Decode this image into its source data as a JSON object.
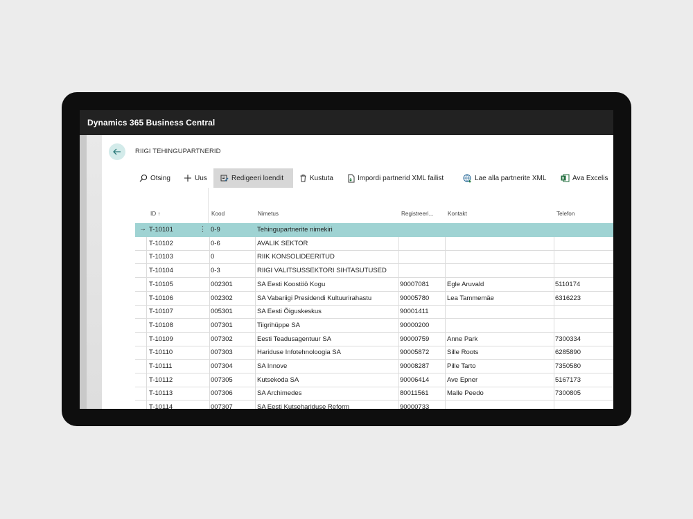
{
  "app": {
    "title": "Dynamics 365 Business Central"
  },
  "page": {
    "title": "RIIGI TEHINGUPARTNERID"
  },
  "toolbar": {
    "search": "Otsing",
    "new": "Uus",
    "edit_list": "Redigeeri loendit",
    "delete": "Kustuta",
    "import": "Impordi partnerid XML failist",
    "download": "Lae alla partnerite XML",
    "excel": "Ava Excelis"
  },
  "columns": {
    "id": "ID",
    "id_sort": "↑",
    "kood": "Kood",
    "nimetus": "Nimetus",
    "registreeri": "Registreeri...",
    "kontakt": "Kontakt",
    "telefon": "Telefon"
  },
  "rows": [
    {
      "id": "T-10101",
      "kood": "0-9",
      "nimetus": "Tehingupartnerite nimekiri",
      "reg": "",
      "kontakt": "",
      "telefon": "",
      "selected": true
    },
    {
      "id": "T-10102",
      "kood": "0-6",
      "nimetus": "AVALIK SEKTOR",
      "reg": "",
      "kontakt": "",
      "telefon": ""
    },
    {
      "id": "T-10103",
      "kood": "0",
      "nimetus": "RIIK KONSOLIDEERITUD",
      "reg": "",
      "kontakt": "",
      "telefon": ""
    },
    {
      "id": "T-10104",
      "kood": "0-3",
      "nimetus": "RIIGI VALITSUSSEKTORI SIHTASUTUSED",
      "reg": "",
      "kontakt": "",
      "telefon": ""
    },
    {
      "id": "T-10105",
      "kood": "002301",
      "nimetus": "SA Eesti Koostöö Kogu",
      "reg": "90007081",
      "kontakt": "Egle Aruvald",
      "telefon": "5110174"
    },
    {
      "id": "T-10106",
      "kood": "002302",
      "nimetus": "SA Vabariigi Presidendi Kultuurirahastu",
      "reg": "90005780",
      "kontakt": "Lea Tammemäe",
      "telefon": "6316223"
    },
    {
      "id": "T-10107",
      "kood": "005301",
      "nimetus": "SA Eesti Õiguskeskus",
      "reg": "90001411",
      "kontakt": "",
      "telefon": ""
    },
    {
      "id": "T-10108",
      "kood": "007301",
      "nimetus": "Tiigrihüppe SA",
      "reg": "90000200",
      "kontakt": "",
      "telefon": ""
    },
    {
      "id": "T-10109",
      "kood": "007302",
      "nimetus": "Eesti Teadusagentuur SA",
      "reg": "90000759",
      "kontakt": "Anne Park",
      "telefon": "7300334"
    },
    {
      "id": "T-10110",
      "kood": "007303",
      "nimetus": "Hariduse Infotehnoloogia SA",
      "reg": "90005872",
      "kontakt": "Sille Roots",
      "telefon": "6285890"
    },
    {
      "id": "T-10111",
      "kood": "007304",
      "nimetus": "SA Innove",
      "reg": "90008287",
      "kontakt": "Pille Tarto",
      "telefon": "7350580"
    },
    {
      "id": "T-10112",
      "kood": "007305",
      "nimetus": "Kutsekoda SA",
      "reg": "90006414",
      "kontakt": "Ave Epner",
      "telefon": "5167173"
    },
    {
      "id": "T-10113",
      "kood": "007306",
      "nimetus": "SA Archimedes",
      "reg": "80011561",
      "kontakt": "Malle Peedo",
      "telefon": "7300805"
    },
    {
      "id": "T-10114",
      "kood": "007307",
      "nimetus": "SA Eesti Kutsehariduse Reform",
      "reg": "90000733",
      "kontakt": "",
      "telefon": ""
    }
  ],
  "colors": {
    "accent": "#9fd3d3",
    "appbar": "#222222"
  },
  "icons": [
    "back-arrow-icon",
    "search-icon",
    "plus-icon",
    "edit-list-icon",
    "trash-icon",
    "import-icon",
    "globe-download-icon",
    "excel-icon",
    "row-arrow-icon",
    "more-vertical-icon"
  ]
}
